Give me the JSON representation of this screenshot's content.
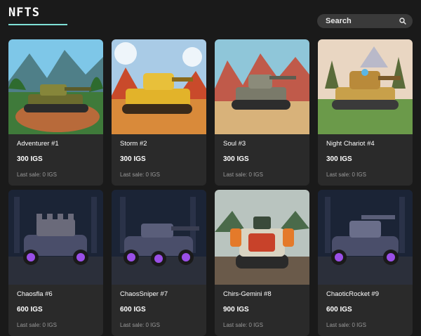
{
  "header": {
    "logo": "NFTS",
    "accent_color": "#7fe0d6",
    "search_label": "Search",
    "search_icon": "search-icon"
  },
  "cards": [
    {
      "name": "Adventurer #1",
      "price": "300 IGS",
      "last_sale": "Last sale: 0 IGS",
      "theme": "jungle"
    },
    {
      "name": "Storm #2",
      "price": "300 IGS",
      "last_sale": "Last sale: 0 IGS",
      "theme": "desert-yellow"
    },
    {
      "name": "Soul #3",
      "price": "300 IGS",
      "last_sale": "Last sale: 0 IGS",
      "theme": "canyon"
    },
    {
      "name": "Night Chariot #4",
      "price": "300 IGS",
      "last_sale": "Last sale: 0 IGS",
      "theme": "forest"
    },
    {
      "name": "Chaosfla #6",
      "price": "600 IGS",
      "last_sale": "Last sale: 0 IGS",
      "theme": "purple-city"
    },
    {
      "name": "ChaosSniper #7",
      "price": "600 IGS",
      "last_sale": "Last sale: 0 IGS",
      "theme": "purple-city"
    },
    {
      "name": "Chirs-Gemini #8",
      "price": "900 IGS",
      "last_sale": "Last sale: 0 IGS",
      "theme": "mech"
    },
    {
      "name": "ChaoticRocket #9",
      "price": "600 IGS",
      "last_sale": "Last sale: 0 IGS",
      "theme": "purple-city"
    }
  ]
}
